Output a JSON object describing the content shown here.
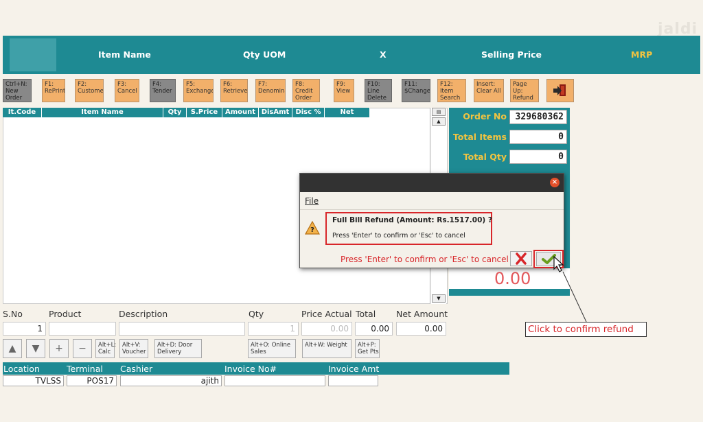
{
  "watermark": "jaldi",
  "header": {
    "item_name": "Item Name",
    "qty_uom": "Qty UOM",
    "x": "X",
    "selling_price": "Selling Price",
    "mrp": "MRP"
  },
  "toolbar": [
    {
      "key": "Ctrl+N:",
      "label": "New Order",
      "style": "gray"
    },
    {
      "key": "F1:",
      "label": "RePrint",
      "style": "orange"
    },
    {
      "key": "F2:",
      "label": "Customer",
      "style": "orange"
    },
    {
      "key": "F3:",
      "label": "Cancel",
      "style": "orange"
    },
    {
      "key": "F4:",
      "label": "Tender",
      "style": "gray"
    },
    {
      "key": "F5:",
      "label": "Exchange",
      "style": "orange"
    },
    {
      "key": "F6:",
      "label": "Retrieve",
      "style": "orange"
    },
    {
      "key": "F7:",
      "label": "Denomina",
      "style": "orange"
    },
    {
      "key": "F8:",
      "label": "Credit Order",
      "style": "orange"
    },
    {
      "key": "F9:",
      "label": "View",
      "style": "orange"
    },
    {
      "key": "F10:",
      "label": "Line Delete",
      "style": "gray"
    },
    {
      "key": "F11:",
      "label": "$Change",
      "style": "gray"
    },
    {
      "key": "F12:",
      "label": "Item Search",
      "style": "orange"
    },
    {
      "key": "Insert:",
      "label": "Clear All",
      "style": "orange"
    },
    {
      "key": "Page Up:",
      "label": "Refund",
      "style": "orange"
    }
  ],
  "grid": {
    "columns": [
      "It.Code",
      "Item Name",
      "Qty",
      "S.Price",
      "Amount",
      "DisAmt",
      "Disc %",
      "Net Amount"
    ]
  },
  "summary": {
    "order_no_label": "Order No",
    "order_no": "329680362",
    "total_items_label": "Total Items",
    "total_items": "0",
    "total_qty_label": "Total Qty",
    "total_qty": "0",
    "net_amount": "0.00"
  },
  "entry": {
    "sno_label": "S.No",
    "product_label": "Product",
    "description_label": "Description",
    "qty_label": "Qty",
    "price_actual_label": "Price Actual",
    "total_label": "Total",
    "net_amount_label": "Net Amount",
    "sno": "1",
    "product": "",
    "description": "",
    "qty": "1",
    "price_actual": "0.00",
    "total": "0.00",
    "net_amount": "0.00"
  },
  "actions": {
    "calc": "Alt+L: Calc",
    "voucher": "Alt+V: Voucher",
    "door_delivery": "Alt+D: Door Delivery",
    "online_sales": "Alt+O: Online Sales",
    "weight": "Alt+W: Weight",
    "get_pts": "Alt+P: Get Pts"
  },
  "footer": {
    "location_label": "Location",
    "terminal_label": "Terminal",
    "cashier_label": "Cashier",
    "invoice_no_label": "Invoice No#",
    "invoice_amt_label": "Invoice Amt",
    "location": "TVLSS",
    "terminal": "POS17",
    "cashier": "ajith",
    "invoice_no": "",
    "invoice_amt": ""
  },
  "dialog": {
    "menu": "File",
    "title_line": "Full Bill Refund (Amount: Rs.1517.00) ?",
    "message": "Press 'Enter' to confirm or 'Esc' to cancel",
    "status": "Press 'Enter' to confirm or 'Esc' to cancel"
  },
  "callout": "Click to confirm refund",
  "colors": {
    "teal": "#1e8a93",
    "orange_key": "#f2b06a",
    "accent_yellow": "#f0c341",
    "highlight_red": "#d8262a"
  }
}
